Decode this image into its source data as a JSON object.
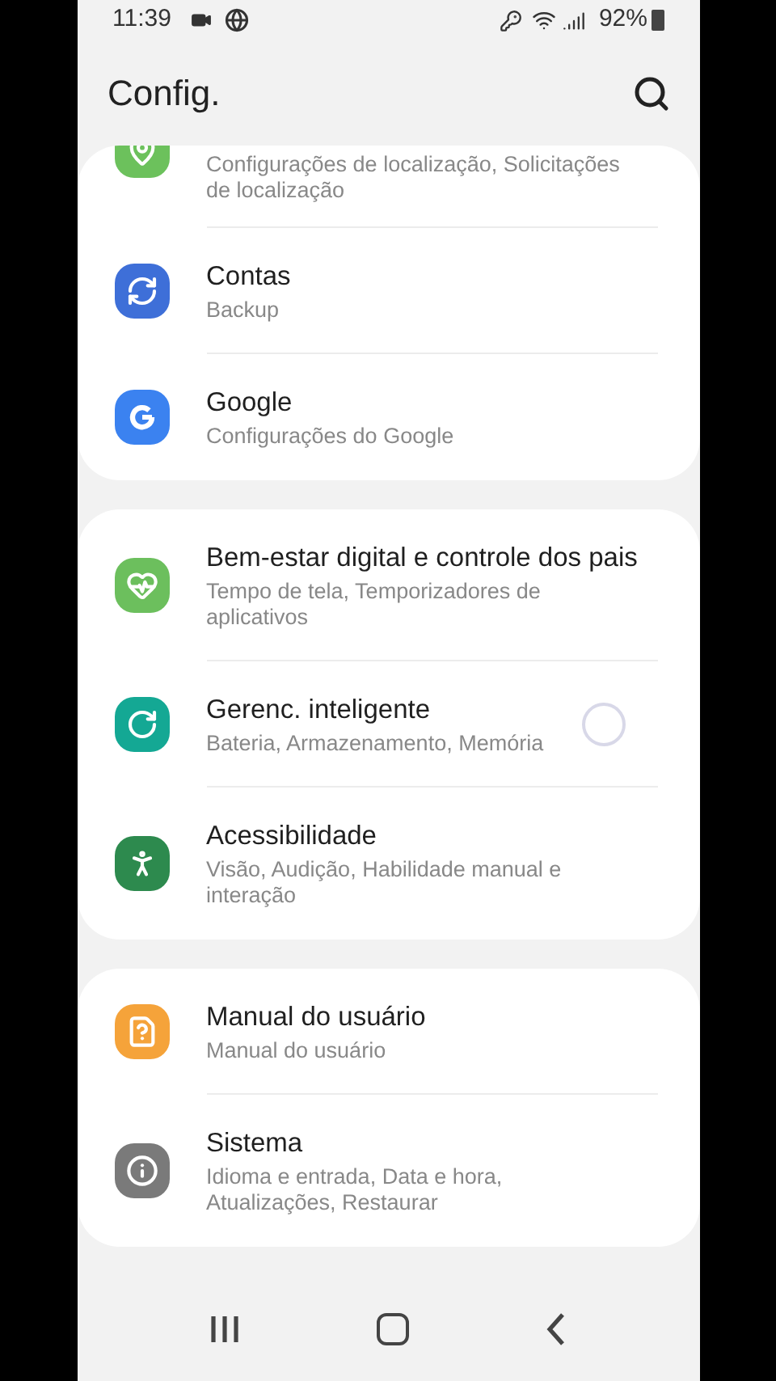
{
  "status_bar": {
    "time": "11:39",
    "battery": "92%"
  },
  "header": {
    "title": "Config."
  },
  "groups": [
    {
      "items": [
        {
          "kind": "location",
          "color": "#6cc15c",
          "subtitle": "Configurações de localização, Solicitações de localização"
        },
        {
          "kind": "accounts",
          "color": "#3e6fd8",
          "title": "Contas",
          "subtitle": "Backup"
        },
        {
          "kind": "google",
          "color": "#3b82f0",
          "title": "Google",
          "subtitle": "Configurações do Google"
        }
      ]
    },
    {
      "items": [
        {
          "kind": "wellbeing",
          "color": "#6cbf5d",
          "title": "Bem-estar digital e controle dos pais",
          "subtitle": "Tempo de tela, Temporizadores de aplicativos"
        },
        {
          "kind": "care",
          "color": "#14a894",
          "title": "Gerenc. inteligente",
          "subtitle": "Bateria, Armazenamento, Memória",
          "touched": true
        },
        {
          "kind": "accessibility",
          "color": "#2d8a4e",
          "title": "Acessibilidade",
          "subtitle": "Visão, Audição, Habilidade manual e interação"
        }
      ]
    },
    {
      "items": [
        {
          "kind": "manual",
          "color": "#f5a33a",
          "title": "Manual do usuário",
          "subtitle": "Manual do usuário"
        },
        {
          "kind": "system",
          "color": "#7a7a7a",
          "title": "Sistema",
          "subtitle": "Idioma e entrada, Data e hora, Atualizações, Restaurar"
        }
      ]
    }
  ]
}
